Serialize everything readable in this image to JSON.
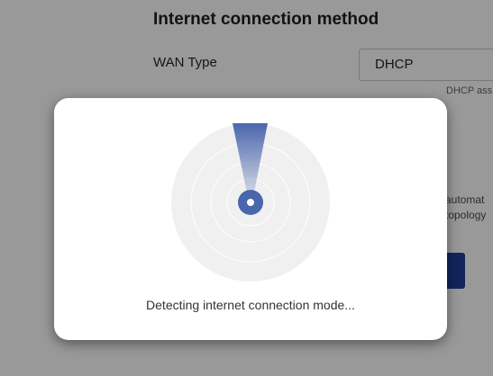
{
  "settings": {
    "section_title": "Internet connection method",
    "wan_type_label": "WAN Type",
    "wan_type_value": "DHCP",
    "wan_type_hint": "DHCP ass",
    "description_line1": "automat",
    "description_line2": "topology",
    "next_button_label": ""
  },
  "dialog": {
    "message": "Detecting internet connection mode...",
    "icon": "radar-scan-icon"
  },
  "colors": {
    "overlay": "rgba(0,0,0,0.4)",
    "accent": "#4a66ac",
    "radar_background": "#f0f0f0",
    "button": "#1f3f9a"
  }
}
